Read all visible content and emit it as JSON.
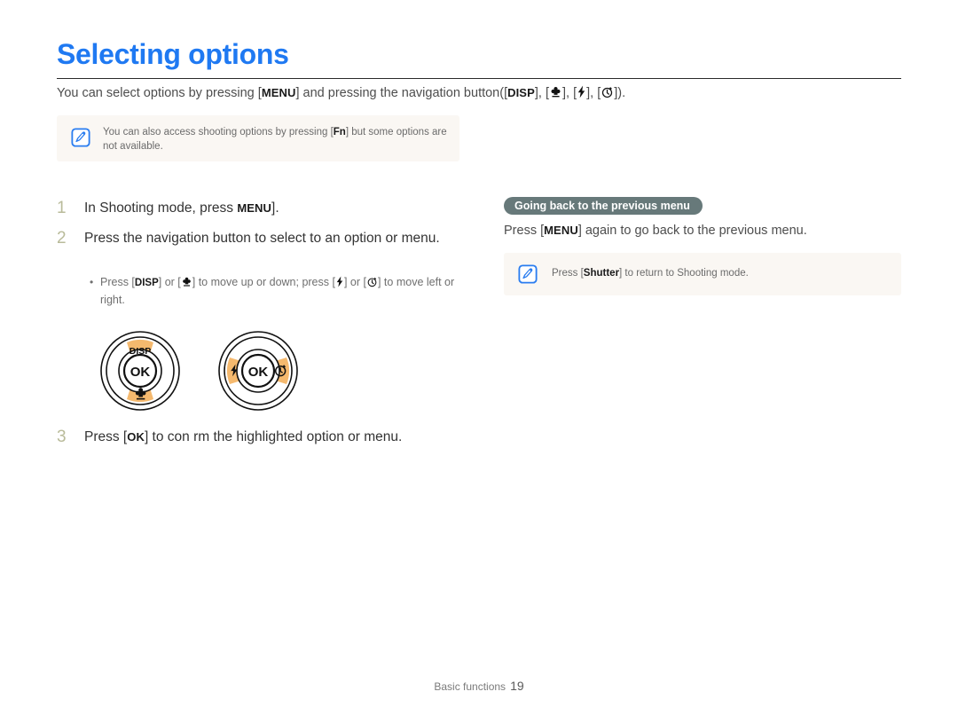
{
  "page": {
    "title": "Selecting options",
    "intro": {
      "part1": "You can select options by pressing [",
      "key_menu": "MENU",
      "part2": "] and pressing the navigation button([",
      "key_disp": "DISP",
      "part3": "], [",
      "part4": "], [",
      "part5": "], [",
      "part6": "])."
    }
  },
  "note1": {
    "icon": "note-pen-icon",
    "part1": "You can also access shooting options by pressing [",
    "key_fn": "Fn",
    "part2": "] but some options are not available."
  },
  "steps": [
    {
      "number": "1",
      "text_before": "In Shooting mode, press ",
      "key": "MENU",
      "text_after": "]."
    },
    {
      "number": "2",
      "text": "Press the navigation button to select to an option or menu.",
      "bullet": {
        "marker": "•",
        "part1": "Press [",
        "key_disp": "DISP",
        "part2": "] or [",
        "part3": "] to move up or down; press [",
        "part4": "] or [",
        "part5": "] to move left or right."
      }
    },
    {
      "number": "3",
      "text_before": "Press [",
      "key": "OK",
      "text_after": "] to con rm the highlighted option or menu."
    }
  ],
  "dials": [
    {
      "name": "vertical-navigation-dial",
      "center_label": "OK",
      "top_label": "DISP",
      "top_icon": "disp-icon",
      "bottom_icon": "macro-flower-icon",
      "highlight_positions": [
        "top",
        "bottom"
      ]
    },
    {
      "name": "horizontal-navigation-dial",
      "center_label": "OK",
      "left_icon": "flash-icon",
      "right_icon": "timer-icon",
      "highlight_positions": [
        "left",
        "right"
      ]
    }
  ],
  "right_column": {
    "pill_label": "Going back to the previous menu",
    "line": {
      "part1": "Press [",
      "key_menu": "MENU",
      "part2": "] again to go back to the previous menu."
    }
  },
  "note2": {
    "icon": "note-pen-icon",
    "part1": "Press [",
    "key_shutter": "Shutter",
    "part2": "] to return to Shooting mode."
  },
  "footer": {
    "section": "Basic functions",
    "page_number": "19"
  },
  "colors": {
    "title_blue": "#1f79f2",
    "step_number": "#b9bb9a",
    "pill_bg": "#67797a",
    "note_bg": "#faf7f3",
    "highlight_orange": "#f5b96e",
    "note_icon_blue": "#2a7df0"
  }
}
